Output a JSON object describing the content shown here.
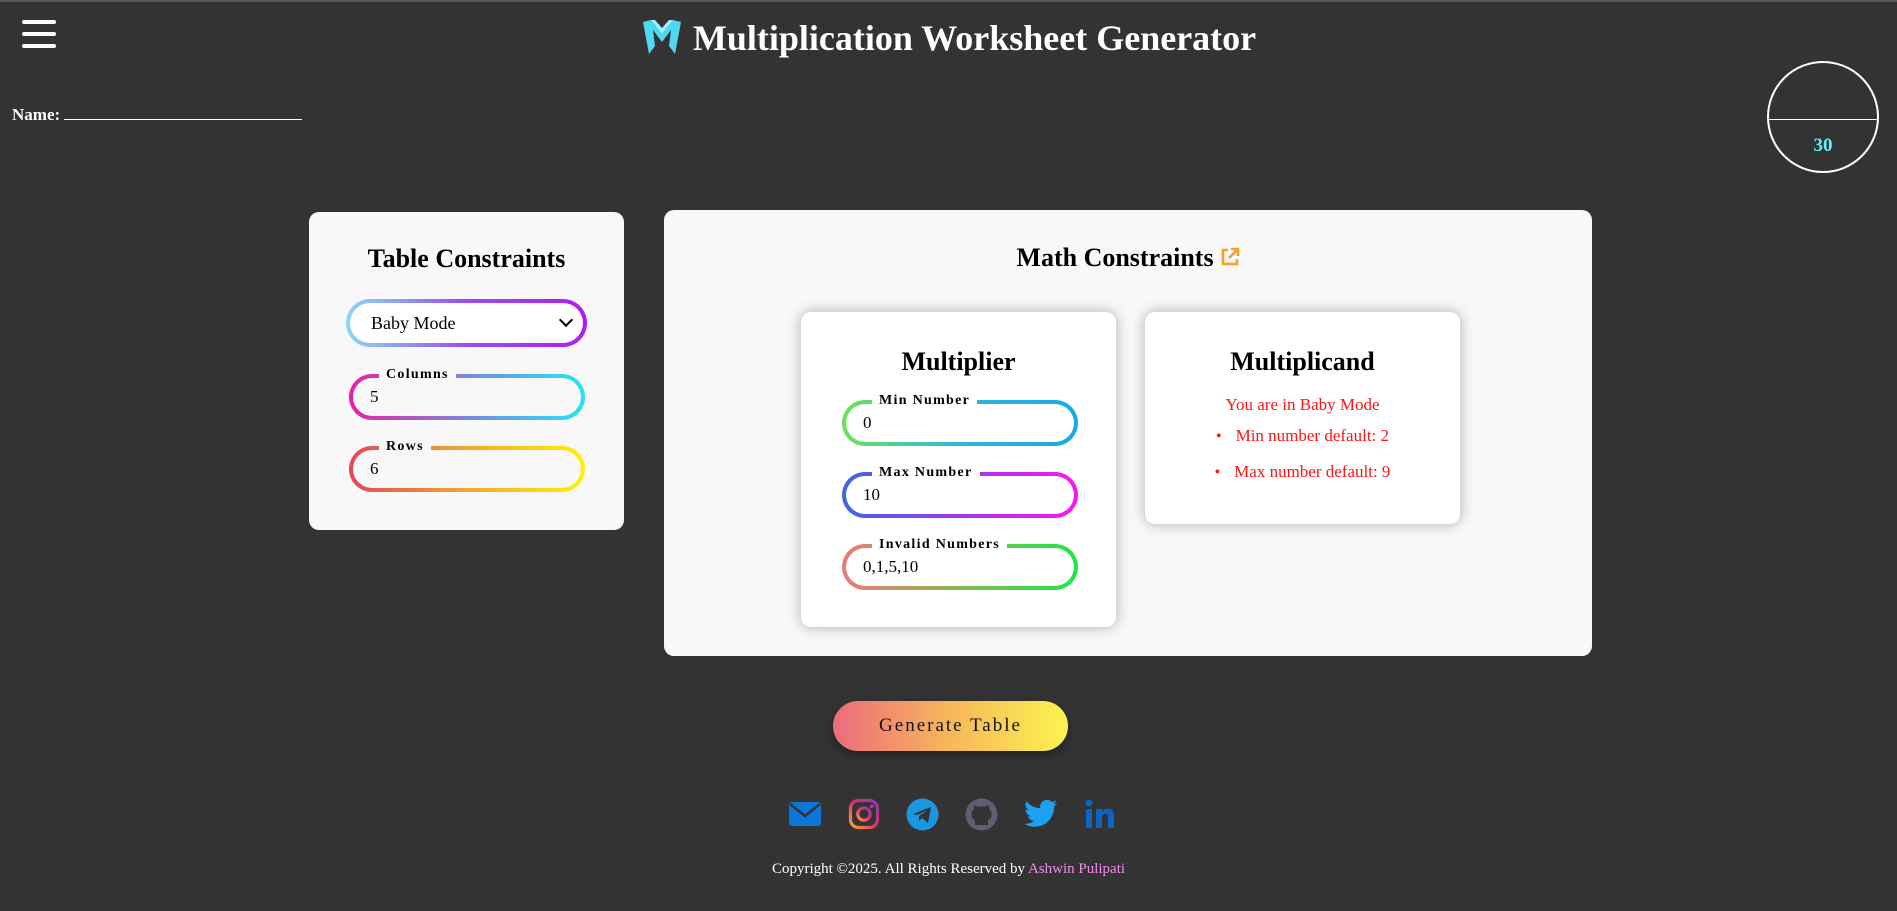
{
  "header": {
    "title": "Multiplication Worksheet Generator",
    "name_label": "Name:",
    "score": "30"
  },
  "table_constraints": {
    "title": "Table Constraints",
    "mode": "Baby Mode",
    "columns_label": "Columns",
    "columns_value": "5",
    "rows_label": "Rows",
    "rows_value": "6"
  },
  "math_constraints": {
    "title": "Math Constraints",
    "multiplier": {
      "title": "Multiplier",
      "min_label": "Min Number",
      "min_value": "0",
      "max_label": "Max Number",
      "max_value": "10",
      "invalid_label": "Invalid Numbers",
      "invalid_value": "0,1,5,10"
    },
    "multiplicand": {
      "title": "Multiplicand",
      "message": "You are in Baby Mode",
      "defaults": [
        "Min number default: 2",
        "Max number default: 9"
      ]
    }
  },
  "generate_label": "Generate Table",
  "social_icons": [
    "email-icon",
    "instagram-icon",
    "telegram-icon",
    "github-icon",
    "twitter-icon",
    "linkedin-icon"
  ],
  "footer": {
    "copyright": "Copyright ©2025. All Rights Reserved by ",
    "author": "Ashwin Pulipati"
  },
  "colors": {
    "background": "#333333",
    "card": "#f8f8f8",
    "score_accent": "#5ff3ff",
    "warning": "#ff1414",
    "author_link": "#f08cf0",
    "external_link": "#f6a323"
  }
}
